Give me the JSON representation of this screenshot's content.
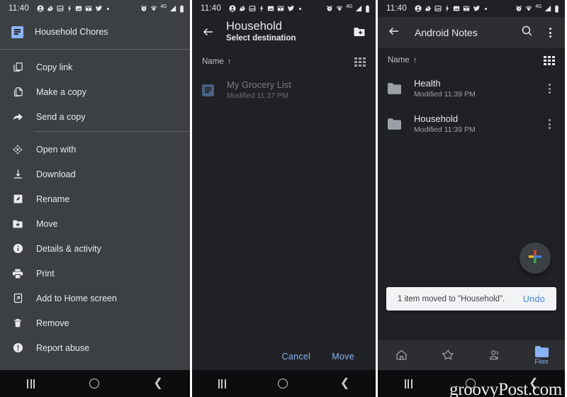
{
  "colors": {
    "menu_bg": "#3c4043",
    "screen_bg": "#202124",
    "appbar_bg": "#2d2e31",
    "accent_blue": "#8ab4f8",
    "snackbar_bg": "#f1f3f4",
    "snackbar_action": "#4285f4",
    "text_primary": "#e8eaed",
    "text_secondary": "#9aa0a6"
  },
  "statusbar": {
    "time": "11:40",
    "left_icons": [
      "account-icon",
      "drive-icon",
      "photo-message-icon",
      "flash-icon",
      "image-icon",
      "book-icon",
      "twitter-icon",
      "more-dot-icon"
    ],
    "right_icons": [
      "alarm-icon",
      "wifi-icon",
      "network-4g-label",
      "signal-icon",
      "battery-icon"
    ],
    "network_label": "4G"
  },
  "panel1": {
    "name": "drive-file-context-menu",
    "header": {
      "icon": "google-docs-icon",
      "title": "Household Chores"
    },
    "menu_groups": [
      {
        "items": [
          {
            "icon": "copy-link-icon",
            "label": "Copy link"
          },
          {
            "icon": "make-a-copy-icon",
            "label": "Make a copy"
          },
          {
            "icon": "send-a-copy-icon",
            "label": "Send a copy"
          }
        ]
      },
      {
        "items": [
          {
            "icon": "open-with-icon",
            "label": "Open with"
          },
          {
            "icon": "download-icon",
            "label": "Download"
          },
          {
            "icon": "rename-icon",
            "label": "Rename"
          },
          {
            "icon": "move-icon",
            "label": "Move"
          },
          {
            "icon": "details-activity-icon",
            "label": "Details & activity"
          },
          {
            "icon": "print-icon",
            "label": "Print"
          },
          {
            "icon": "add-to-home-screen-icon",
            "label": "Add to Home screen"
          },
          {
            "icon": "remove-trash-icon",
            "label": "Remove"
          },
          {
            "icon": "report-abuse-icon",
            "label": "Report abuse"
          }
        ]
      }
    ]
  },
  "panel2": {
    "name": "select-destination-screen",
    "appbar": {
      "back_icon": "back-arrow-icon",
      "title": "Household",
      "subtitle": "Select destination",
      "new_folder_icon": "create-new-folder-icon"
    },
    "sortbar": {
      "label": "Name",
      "arrow": "↑",
      "view_toggle_icon": "grid-view-icon"
    },
    "files": [
      {
        "icon": "google-docs-icon",
        "name": "My Grocery List",
        "meta": "Modified 11:37 PM",
        "disabled": true
      }
    ],
    "actions": {
      "cancel_label": "Cancel",
      "move_label": "Move"
    }
  },
  "panel3": {
    "name": "android-notes-folder-screen",
    "appbar": {
      "back_icon": "back-arrow-icon",
      "title": "Android Notes",
      "search_icon": "search-icon",
      "overflow_icon": "more-vert-icon"
    },
    "sortbar": {
      "label": "Name",
      "arrow": "↑",
      "view_toggle_icon": "grid-view-icon"
    },
    "folders": [
      {
        "icon": "folder-icon",
        "name": "Health",
        "meta": "Modified 11:39 PM",
        "overflow_icon": "more-vert-icon"
      },
      {
        "icon": "folder-icon",
        "name": "Household",
        "meta": "Modified 11:39 PM",
        "overflow_icon": "more-vert-icon"
      }
    ],
    "fab": {
      "icon": "google-plus-add-icon",
      "label": ""
    },
    "snackbar": {
      "message": "1 item moved to \"Household\".",
      "action_label": "Undo"
    },
    "bottom_nav": [
      {
        "icon": "home-icon",
        "label": "",
        "active": false
      },
      {
        "icon": "starred-icon",
        "label": "",
        "active": false
      },
      {
        "icon": "shared-people-icon",
        "label": "",
        "active": false
      },
      {
        "icon": "files-folder-icon",
        "label": "Files",
        "active": true
      }
    ]
  },
  "navbar": {
    "recents_icon": "recents-icon",
    "home_icon": "home-circle-icon",
    "back_icon": "back-chevron-icon"
  },
  "watermark": "groovyPost.com"
}
